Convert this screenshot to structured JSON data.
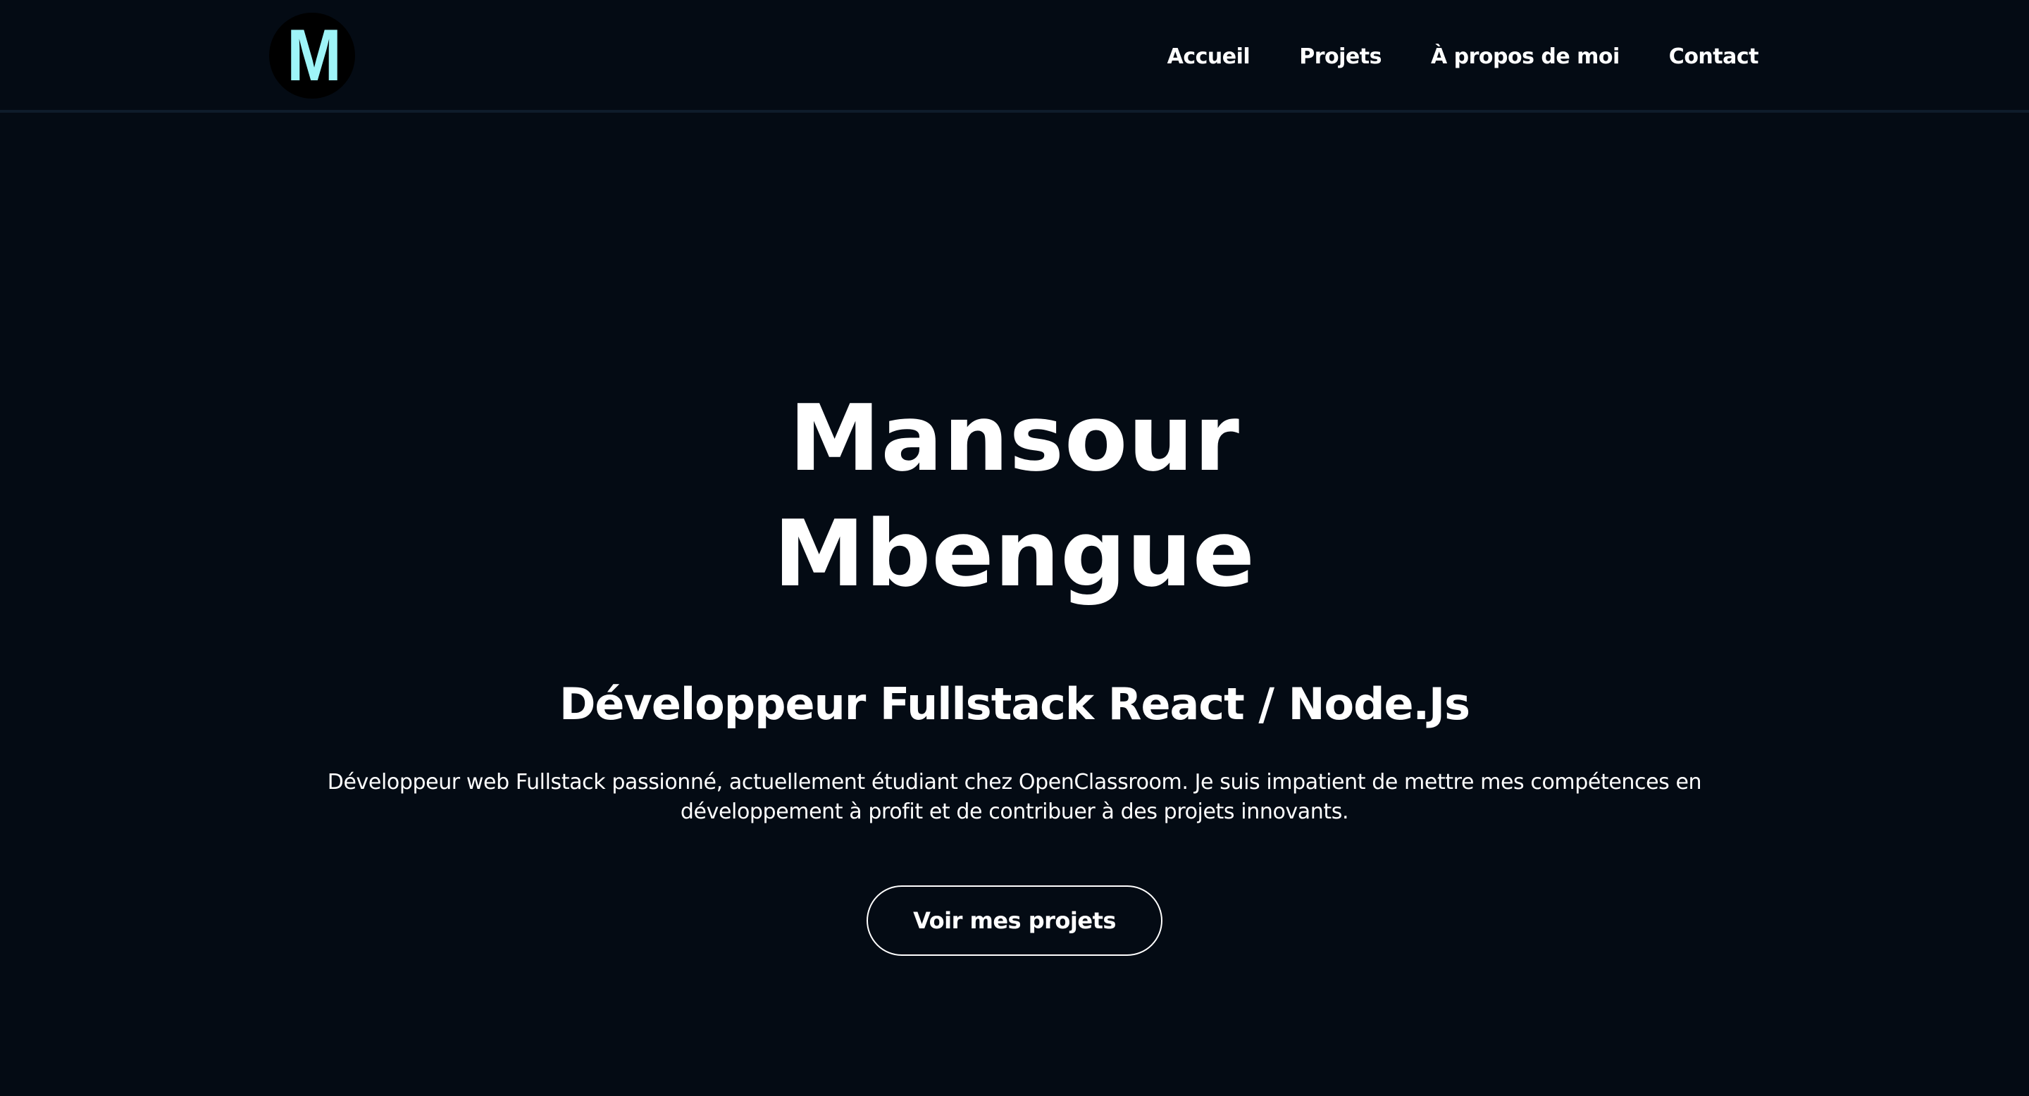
{
  "header": {
    "logo": {
      "letter": "M",
      "icon": "m-monogram-logo"
    },
    "nav": [
      {
        "label": "Accueil"
      },
      {
        "label": "Projets"
      },
      {
        "label": "À propos de moi"
      },
      {
        "label": "Contact"
      }
    ]
  },
  "hero": {
    "name_line1": "Mansour",
    "name_line2": "Mbengue",
    "role": "Développeur Fullstack React / Node.Js",
    "description": "Développeur web Fullstack passionné, actuellement étudiant chez OpenClassroom. Je suis impatient de mettre mes compétences en développement à profit et de contribuer à des projets innovants.",
    "cta_label": "Voir mes projets"
  },
  "colors": {
    "background": "#040b14",
    "text": "#ffffff",
    "logo_accent": "#9ef4f8",
    "header_border": "#0f1c2b"
  }
}
